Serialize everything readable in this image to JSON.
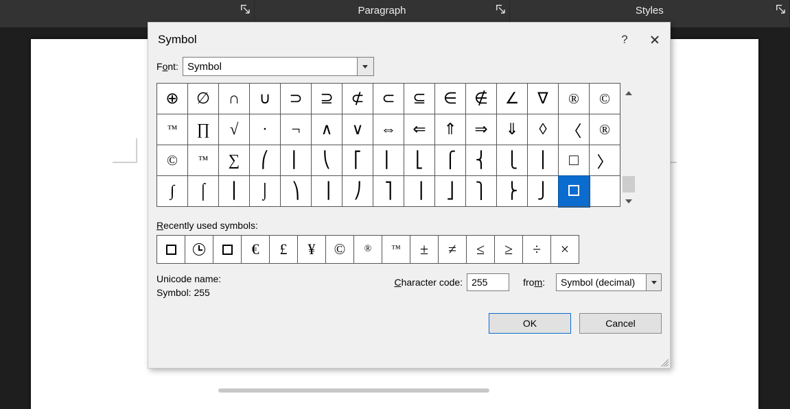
{
  "ribbon": {
    "sections": [
      "",
      "Paragraph",
      "",
      "Styles",
      ""
    ]
  },
  "dialog": {
    "title": "Symbol",
    "help": "?",
    "font_label_pre": "F",
    "font_label_u": "o",
    "font_label_post": "nt:",
    "font_value": "Symbol",
    "recent_label_pre": "R",
    "recent_label_u": "e",
    "recent_label_post": "cently used symbols:",
    "unicode_label": "Unicode name:",
    "unicode_value": "Symbol: 255",
    "cc_label_pre": "C",
    "cc_label_u": "h",
    "cc_label_post": "aracter code:",
    "cc_value": "255",
    "from_label_pre": "fro",
    "from_label_u": "m",
    "from_label_post": ":",
    "from_value": "Symbol (decimal)",
    "ok": "OK",
    "cancel": "Cancel"
  },
  "grid": [
    [
      "⊕",
      "∅",
      "∩",
      "∪",
      "⊃",
      "⊇",
      "⊄",
      "⊂",
      "⊆",
      "∈",
      "∉",
      "∠",
      "∇",
      "®",
      "©"
    ],
    [
      "™",
      "∏",
      "√",
      "·",
      "¬",
      "∧",
      "∨",
      "⇔",
      "⇐",
      "⇑",
      "⇒",
      "⇓",
      "◊",
      "〈",
      "®"
    ],
    [
      "©",
      "™",
      "∑",
      "⎛",
      "⎜",
      "⎝",
      "⎡",
      "⎢",
      "⎣",
      "⎧",
      "⎨",
      "⎩",
      "⎪",
      "□",
      "〉"
    ],
    [
      "∫",
      "⌠",
      "⎮",
      "⌡",
      "⎞",
      "⎟",
      "⎠",
      "⎤",
      "⎥",
      "⎦",
      "⎫",
      "⎬",
      "⎭",
      "SEL",
      ""
    ]
  ],
  "recent": [
    "▢",
    "CLOCK",
    "▢",
    "€",
    "£",
    "¥",
    "©",
    "®",
    "™",
    "±",
    "≠",
    "≤",
    "≥",
    "÷",
    "×"
  ]
}
